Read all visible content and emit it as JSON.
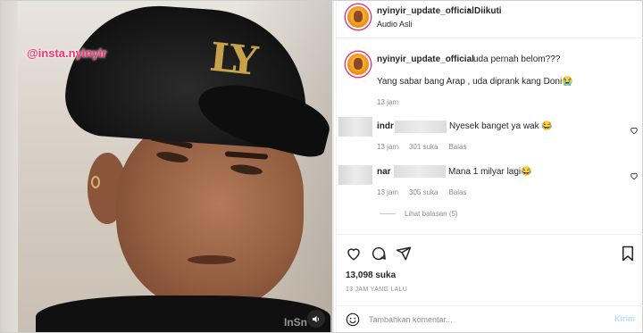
{
  "media": {
    "watermark_top": "@insta.nyinyir",
    "watermark_bottom": "InSn",
    "sound_icon": "speaker-icon"
  },
  "header": {
    "username": "nyinyir_update_official",
    "separator": "•",
    "follow_status": "Diikuti",
    "audio_label": "Audio Asli"
  },
  "caption": {
    "username": "nyinyir_update_official",
    "text_line1": "uda pernah belom???",
    "text_line2": "Yang sabar bang Arap , uda diprank kang Doni😭",
    "time": "13 jam"
  },
  "comments": [
    {
      "username": "indr",
      "text": "Nyesek banget ya wak 😂",
      "time": "13 jam",
      "likes": "301 suka",
      "reply": "Balas"
    },
    {
      "username": "nar",
      "text": "Mana 1 milyar lagi😂",
      "time": "13 jam",
      "likes": "305 suka",
      "reply": "Balas"
    }
  ],
  "replies_link": "Lihat balasan (5)",
  "actions": {
    "icons": [
      "heart-icon",
      "comment-icon",
      "share-icon",
      "bookmark-icon"
    ],
    "likes": "13,098 suka",
    "posted_ago": "13 JAM YANG LALU"
  },
  "composer": {
    "placeholder": "Tambahkan komentar...",
    "post_label": "Kirim"
  },
  "colors": {
    "link_disabled": "#b2dffc",
    "secondary_text": "#8e8e8e",
    "watermark": "#ff2f6e"
  }
}
